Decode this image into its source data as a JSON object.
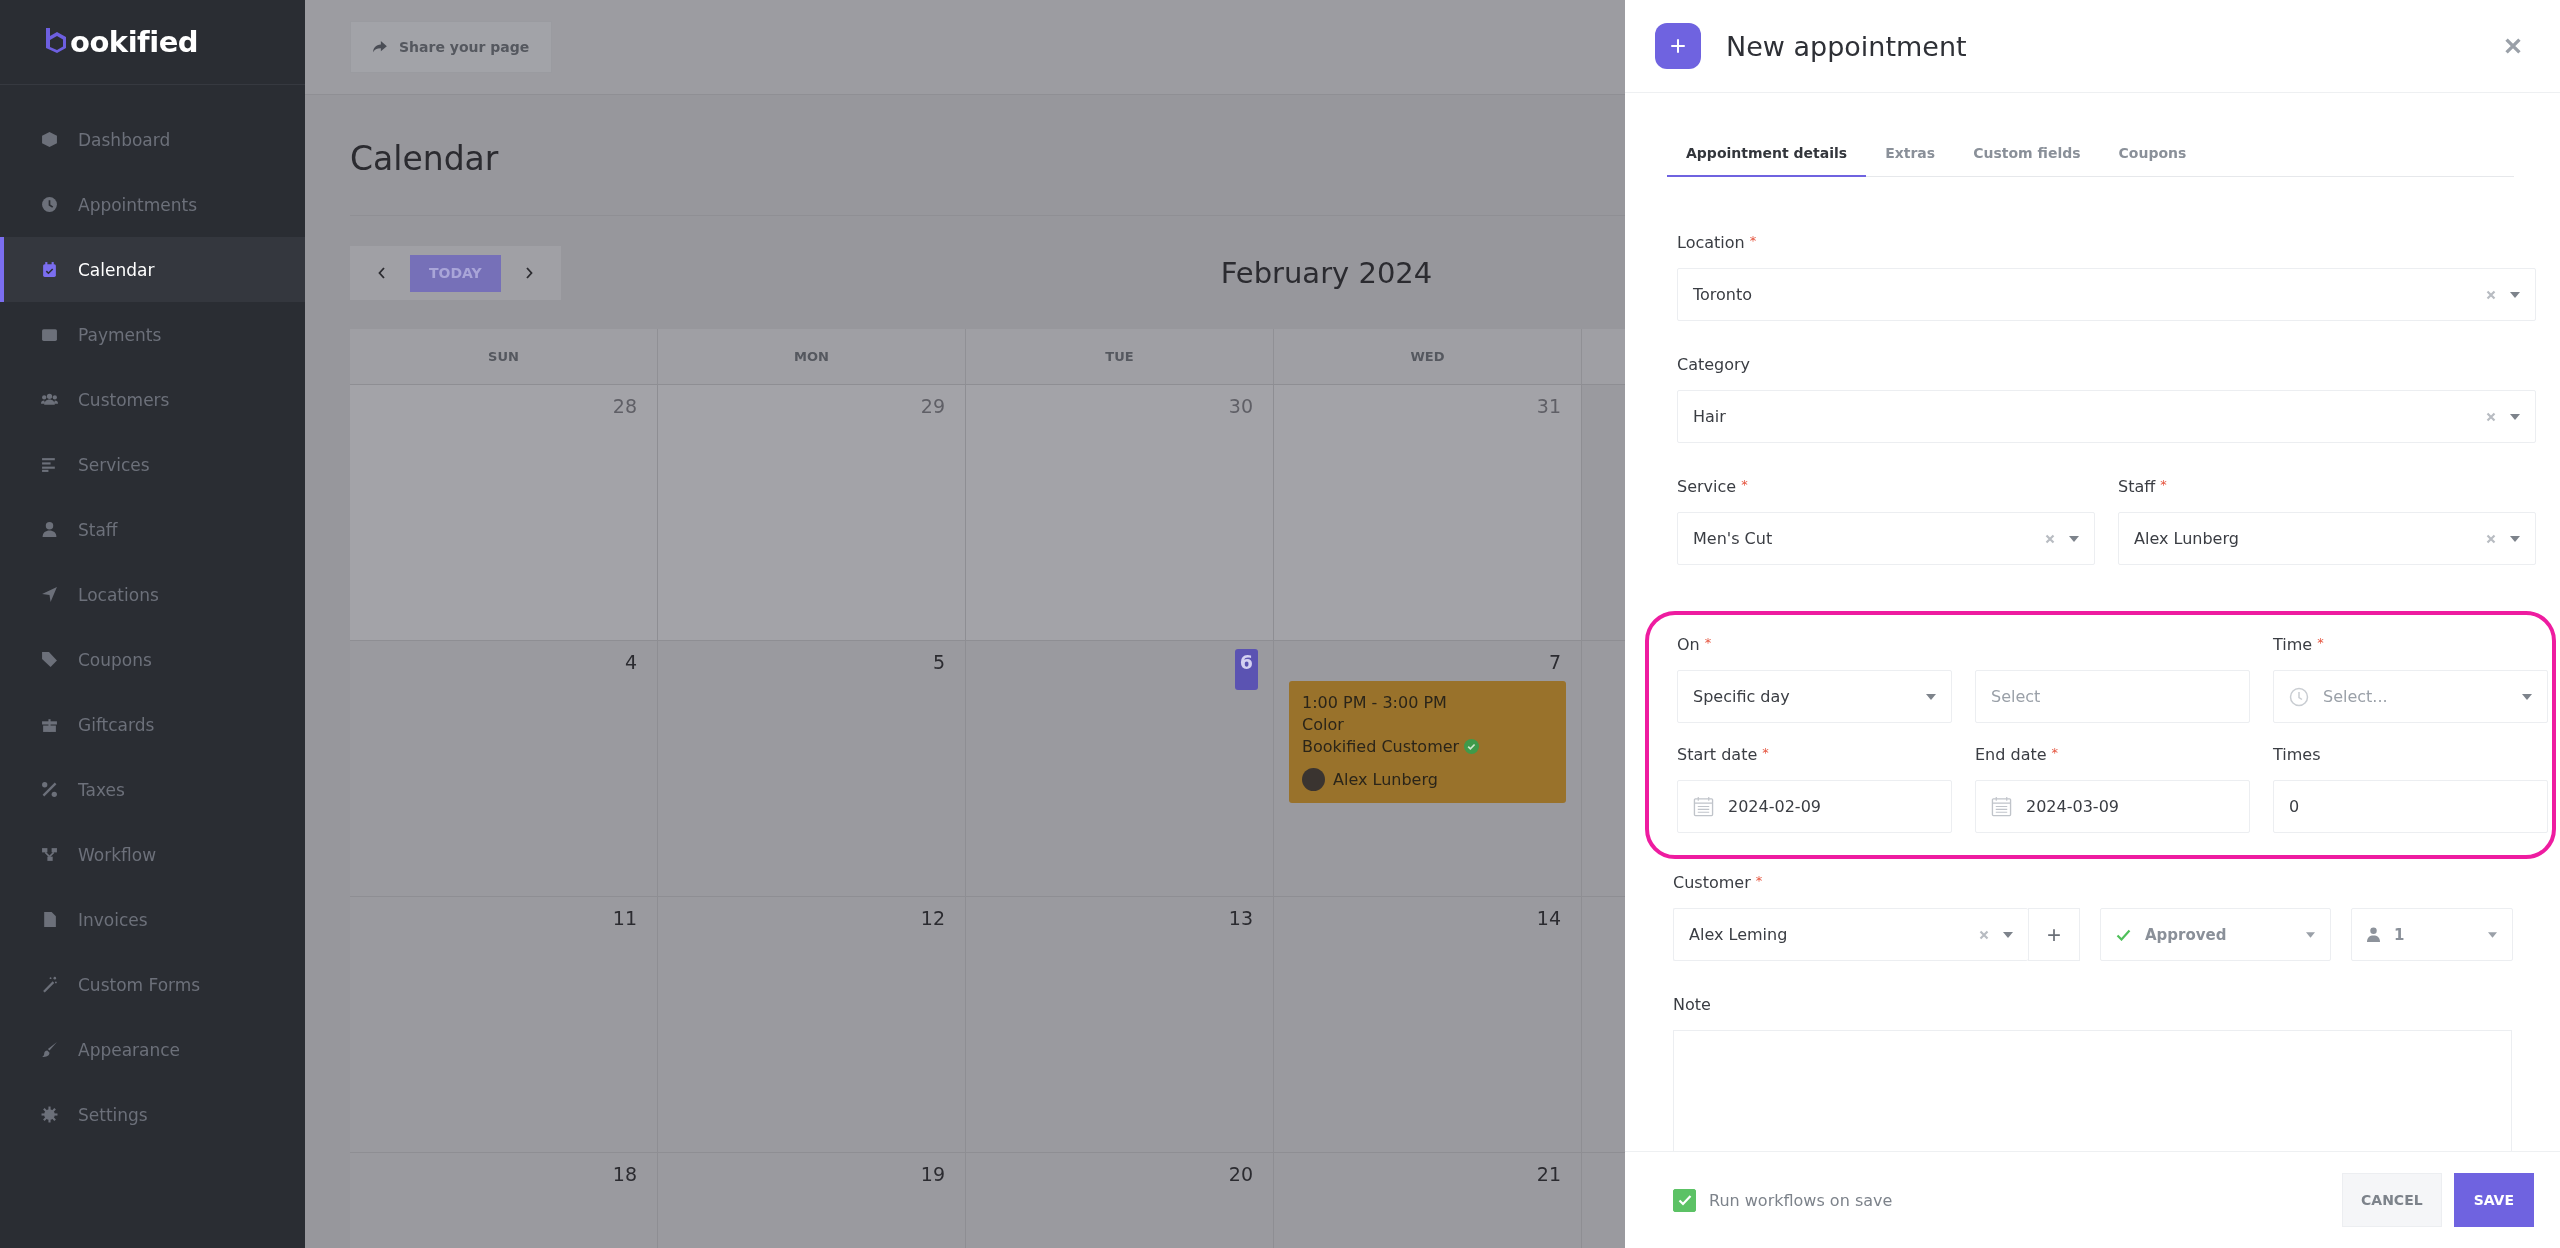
{
  "sidebar": {
    "logo_text": "ookified",
    "items": [
      {
        "label": "Dashboard",
        "selected": false
      },
      {
        "label": "Appointments",
        "selected": false
      },
      {
        "label": "Calendar",
        "selected": true
      },
      {
        "label": "Payments",
        "selected": false
      },
      {
        "label": "Customers",
        "selected": false
      },
      {
        "label": "Services",
        "selected": false
      },
      {
        "label": "Staff",
        "selected": false
      },
      {
        "label": "Locations",
        "selected": false
      },
      {
        "label": "Coupons",
        "selected": false
      },
      {
        "label": "Giftcards",
        "selected": false
      },
      {
        "label": "Taxes",
        "selected": false
      },
      {
        "label": "Workflow",
        "selected": false
      },
      {
        "label": "Invoices",
        "selected": false
      },
      {
        "label": "Custom Forms",
        "selected": false
      },
      {
        "label": "Appearance",
        "selected": false
      },
      {
        "label": "Settings",
        "selected": false
      }
    ]
  },
  "topbar": {
    "share_button": "Share your page"
  },
  "calendar": {
    "title": "Calendar",
    "today_button": "TODAY",
    "month": "February 2024",
    "weekdays": [
      "SUN",
      "MON",
      "TUE",
      "WED"
    ],
    "weeks": [
      [
        {
          "day": "28",
          "other_month": true,
          "today": false
        },
        {
          "day": "29",
          "other_month": true,
          "today": false
        },
        {
          "day": "30",
          "other_month": true,
          "today": false
        },
        {
          "day": "31",
          "other_month": true,
          "today": false
        }
      ],
      [
        {
          "day": "4",
          "other_month": false,
          "today": false
        },
        {
          "day": "5",
          "other_month": false,
          "today": false
        },
        {
          "day": "6",
          "other_month": false,
          "today": true
        },
        {
          "day": "7",
          "other_month": false,
          "today": false,
          "event": {
            "time": "1:00 PM - 3:00 PM",
            "service": "Color",
            "customer": "Bookified Customer",
            "staff": "Alex Lunberg"
          }
        }
      ],
      [
        {
          "day": "11",
          "other_month": false,
          "today": false
        },
        {
          "day": "12",
          "other_month": false,
          "today": false
        },
        {
          "day": "13",
          "other_month": false,
          "today": false
        },
        {
          "day": "14",
          "other_month": false,
          "today": false
        }
      ],
      [
        {
          "day": "18",
          "other_month": false,
          "today": false
        },
        {
          "day": "19",
          "other_month": false,
          "today": false
        },
        {
          "day": "20",
          "other_month": false,
          "today": false
        },
        {
          "day": "21",
          "other_month": false,
          "today": false
        }
      ]
    ]
  },
  "panel": {
    "title": "New appointment",
    "tabs": [
      {
        "label": "Appointment details",
        "selected": true
      },
      {
        "label": "Extras",
        "selected": false
      },
      {
        "label": "Custom fields",
        "selected": false
      },
      {
        "label": "Coupons",
        "selected": false
      }
    ],
    "rows": [
      {
        "fields": [
          {
            "kind": "select",
            "label": "Location",
            "required_mark": "*",
            "value": "Toronto",
            "clearable": true
          }
        ]
      },
      {
        "fields": [
          {
            "kind": "select",
            "label": "Category",
            "value": "Hair",
            "clearable": true
          }
        ]
      },
      {
        "fields": [
          {
            "kind": "select",
            "label": "Service",
            "required_mark": "*",
            "value": "Men's Cut",
            "clearable": true
          },
          {
            "kind": "select",
            "label": "Staff",
            "required_mark": "*",
            "value": "Alex Lunberg",
            "clearable": true
          }
        ]
      }
    ],
    "highlighted_section": {
      "rows": [
        {
          "fields": [
            {
              "kind": "select",
              "label": "On",
              "required_mark": "*",
              "value": "Specific day",
              "clearable": false
            },
            {
              "kind": "input",
              "placeholder": "Select"
            },
            {
              "kind": "time",
              "label": "Time",
              "required_mark": "*",
              "placeholder": "Select..."
            }
          ]
        },
        {
          "fields": [
            {
              "kind": "date",
              "label": "Start date",
              "required_mark": "*",
              "value": "2024-02-09"
            },
            {
              "kind": "date",
              "label": "End date",
              "required_mark": "*",
              "value": "2024-03-09"
            },
            {
              "kind": "input",
              "label": "Times",
              "value": "0"
            }
          ]
        }
      ]
    },
    "customer": {
      "label": "Customer",
      "required_mark": "*",
      "value": "Alex Leming",
      "add_button": "+",
      "status": "Approved",
      "count": "1"
    },
    "note": {
      "label": "Note"
    },
    "footer": {
      "checkbox_label": "Run workflows on save",
      "checked": true,
      "cancel": "CANCEL",
      "save": "SAVE"
    }
  }
}
